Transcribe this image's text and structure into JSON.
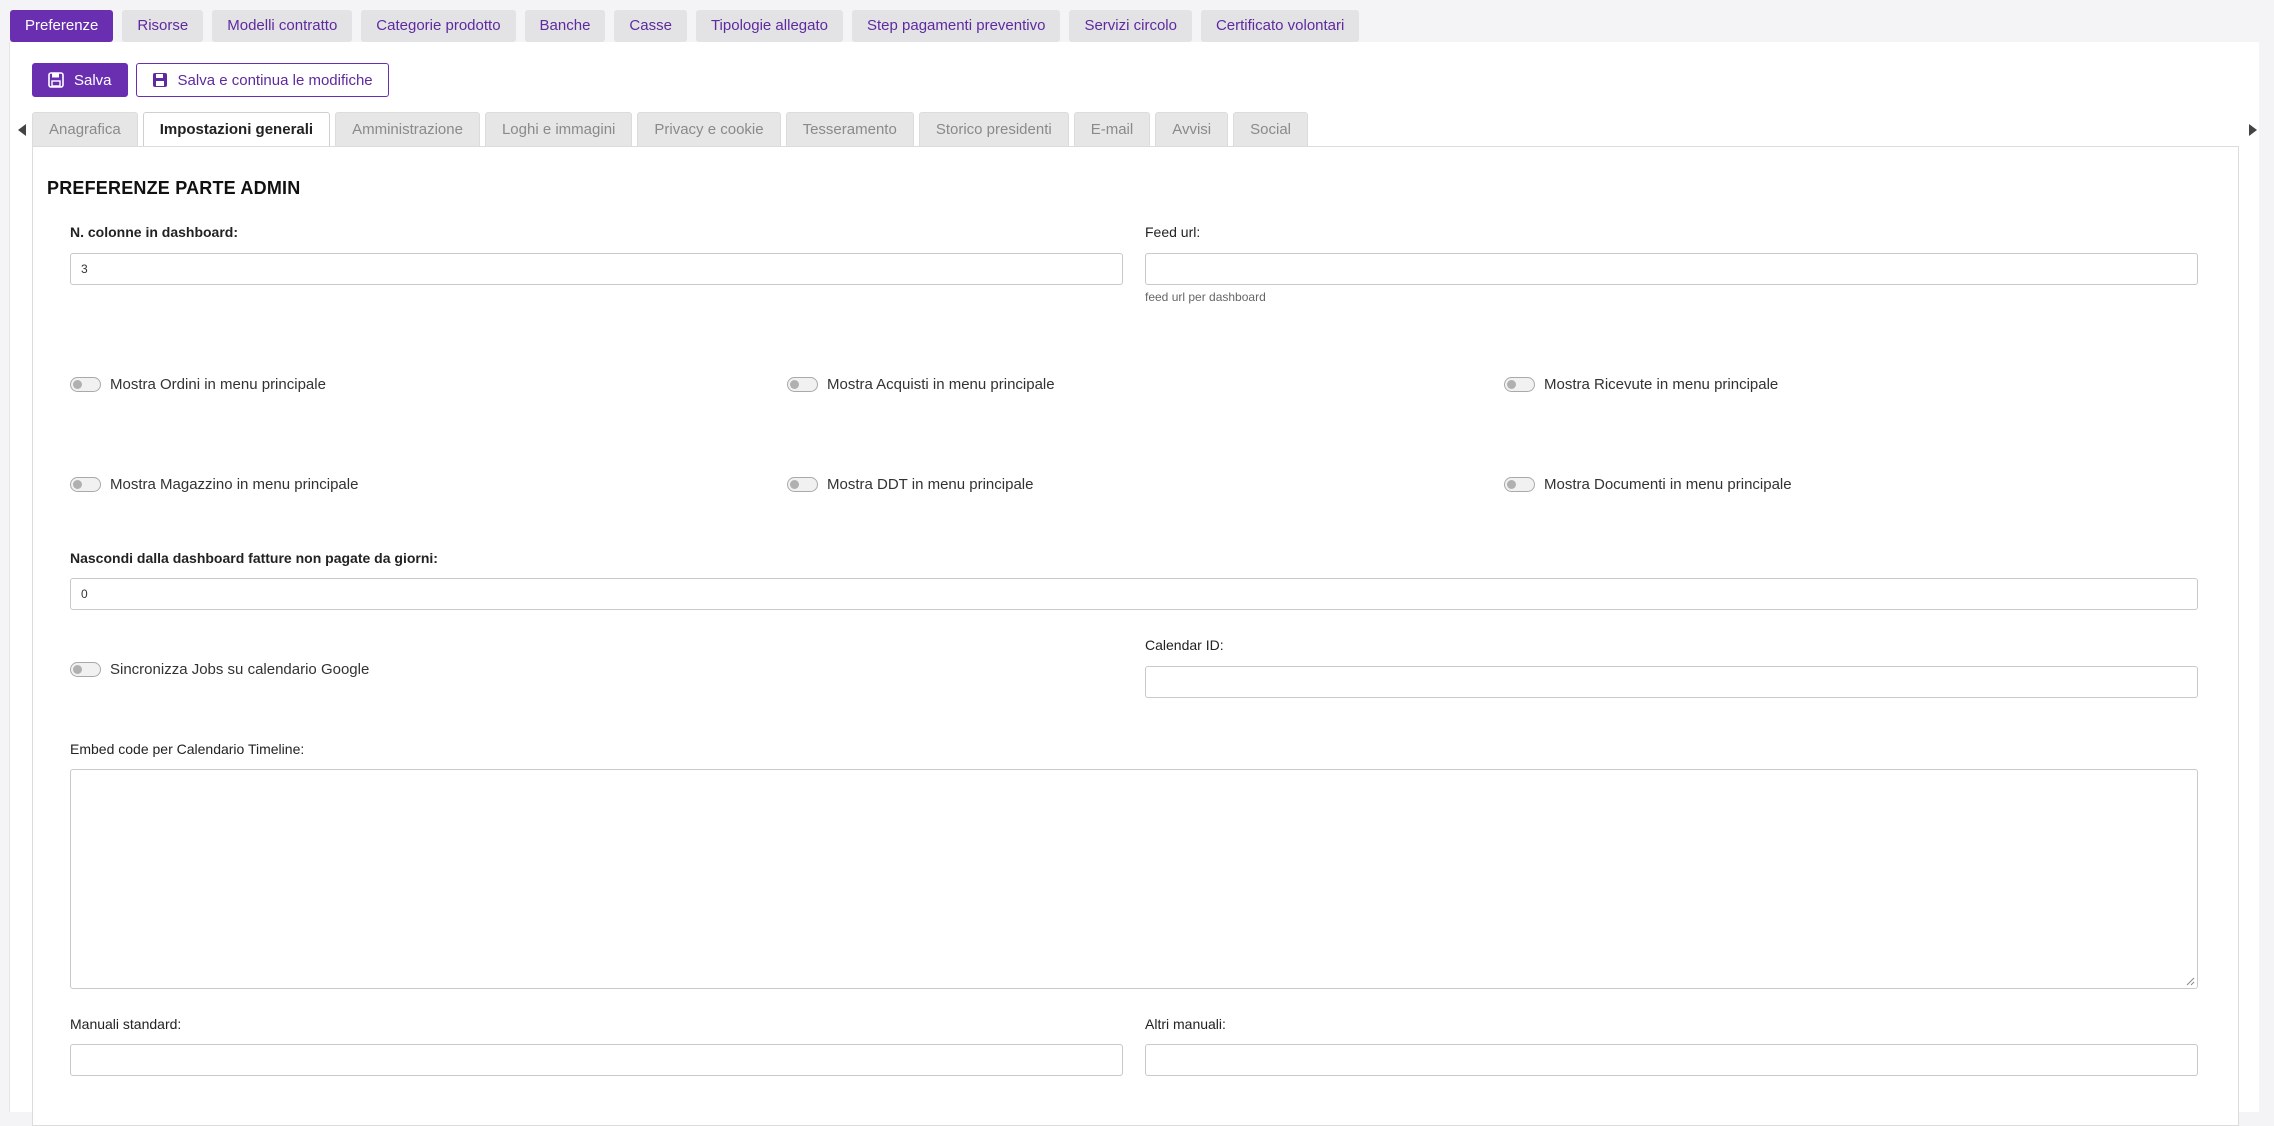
{
  "top_tabs": [
    "Preferenze",
    "Risorse",
    "Modelli contratto",
    "Categorie prodotto",
    "Banche",
    "Casse",
    "Tipologie allegato",
    "Step pagamenti preventivo",
    "Servizi circolo",
    "Certificato volontari"
  ],
  "active_top_tab": "Preferenze",
  "actions": {
    "save_label": "Salva",
    "save_continue_label": "Salva e continua le modifiche"
  },
  "sub_tabs": [
    "Anagrafica",
    "Impostazioni generali",
    "Amministrazione",
    "Loghi e immagini",
    "Privacy e cookie",
    "Tesseramento",
    "Storico presidenti",
    "E-mail",
    "Avvisi",
    "Social"
  ],
  "active_sub_tab": "Impostazioni generali",
  "form": {
    "section_title": "PREFERENZE PARTE ADMIN",
    "dashboard_columns": {
      "label": "N. colonne in dashboard:",
      "value": "3"
    },
    "feed_url": {
      "label": "Feed url:",
      "value": "",
      "help": "feed url per dashboard"
    },
    "toggles": [
      {
        "label": "Mostra Ordini in menu principale",
        "on": false
      },
      {
        "label": "Mostra Acquisti in menu principale",
        "on": false
      },
      {
        "label": "Mostra Ricevute in menu principale",
        "on": false
      },
      {
        "label": "Mostra Magazzino in menu principale",
        "on": false
      },
      {
        "label": "Mostra DDT in menu principale",
        "on": false
      },
      {
        "label": "Mostra Documenti in menu principale",
        "on": false
      }
    ],
    "hide_unpaid": {
      "label": "Nascondi dalla dashboard fatture non pagate da giorni:",
      "value": "0"
    },
    "sync_google": {
      "label": "Sincronizza Jobs su calendario Google",
      "on": false
    },
    "calendar_id": {
      "label": "Calendar ID:",
      "value": ""
    },
    "embed_code": {
      "label": "Embed code per Calendario Timeline:",
      "value": ""
    },
    "standard_manuals": {
      "label": "Manuali standard:",
      "value": ""
    },
    "other_manuals": {
      "label": "Altri manuali:",
      "value": ""
    }
  },
  "colors": {
    "accent": "#6a2fb0",
    "tab_inactive_bg": "#e3e3e6"
  }
}
